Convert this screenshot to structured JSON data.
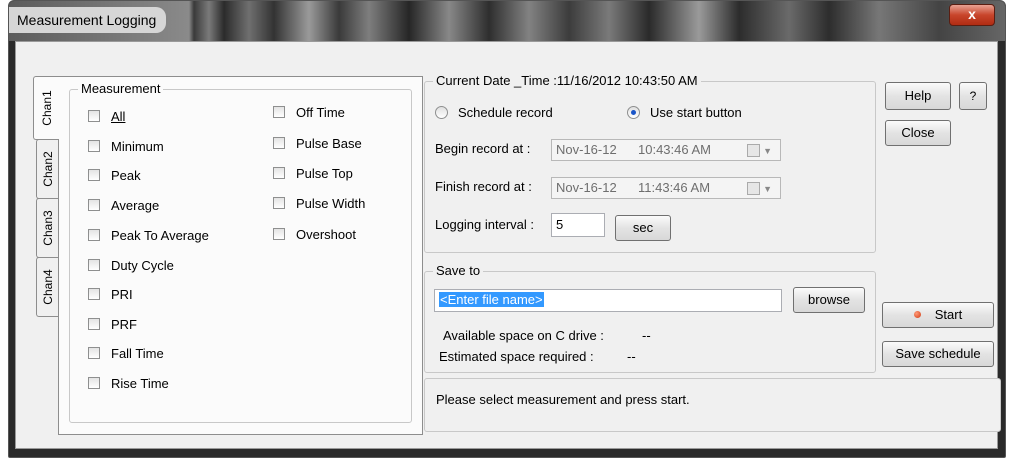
{
  "window": {
    "title": "Measurement Logging",
    "close_glyph": "x"
  },
  "tabs": [
    "Chan1",
    "Chan2",
    "Chan3",
    "Chan4"
  ],
  "measurement": {
    "legend": "Measurement",
    "col1": [
      "All",
      "Minimum",
      "Peak",
      "Average",
      "Peak To Average",
      "Duty Cycle",
      "PRI",
      "PRF",
      "Fall Time",
      "Rise Time"
    ],
    "col2": [
      "Off Time",
      "Pulse Base",
      "Pulse Top",
      "Pulse Width",
      "Overshoot"
    ]
  },
  "schedule": {
    "legend": "Current Date _Time :11/16/2012 10:43:50 AM",
    "radio_schedule": "Schedule record",
    "radio_start": "Use start button",
    "selected": "Use start button",
    "begin_label": "Begin record at :",
    "begin_date": "Nov-16-12",
    "begin_time": "10:43:46  AM",
    "finish_label": "Finish record at :",
    "finish_date": "Nov-16-12",
    "finish_time": "11:43:46  AM",
    "interval_label": "Logging interval :",
    "interval_value": "5",
    "sec_button": "sec"
  },
  "save": {
    "legend": "Save to",
    "file_value": "<Enter file name>",
    "browse_button": "browse",
    "available_label": "Available space on C drive :",
    "available_value": "--",
    "estimated_label": "Estimated space required :",
    "estimated_value": "--"
  },
  "buttons": {
    "help": "Help",
    "help_icon": "?",
    "close": "Close",
    "start": "Start",
    "save_schedule": "Save schedule"
  },
  "status": {
    "message": "Please select measurement and press start."
  }
}
